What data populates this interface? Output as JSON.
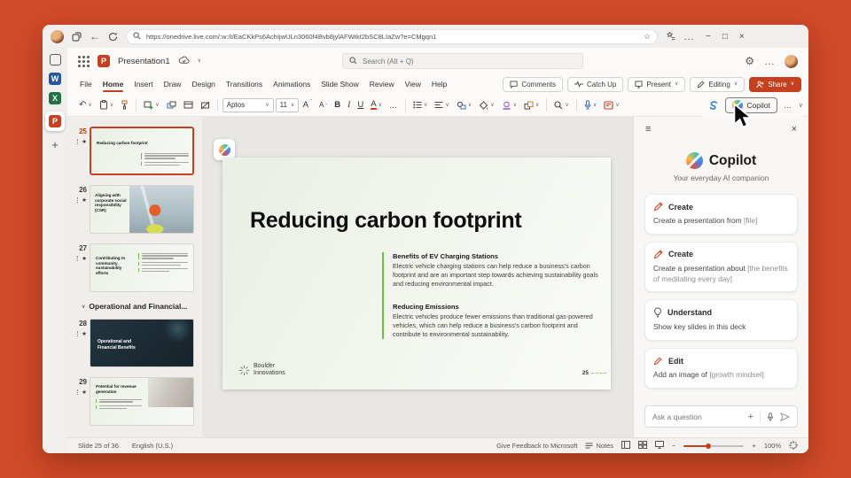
{
  "colors": {
    "accent": "#C4401F",
    "background_orange": "#D14B28",
    "green_accent": "#6FBE44"
  },
  "browser": {
    "url": "https://onedrive.live.com/:w:/t/EaCKkPs6AchIjwULn3060f4Bvb8jylAFWrkt2bSC8LIaZw?e=CMgqn1",
    "window_controls": {
      "minimize": "−",
      "maximize": "□",
      "close": "×"
    }
  },
  "rail": {
    "word": "W",
    "excel": "X",
    "powerpoint": "P",
    "new_tab": "+"
  },
  "app_header": {
    "title": "Presentation1",
    "search_placeholder": "Search (Alt + Q)"
  },
  "menu": {
    "items": [
      "File",
      "Home",
      "Insert",
      "Draw",
      "Design",
      "Transitions",
      "Animations",
      "Slide Show",
      "Review",
      "View",
      "Help"
    ]
  },
  "actions": {
    "comments": "Comments",
    "catch_up": "Catch Up",
    "present": "Present",
    "editing": "Editing",
    "share": "Share"
  },
  "toolbar": {
    "font_name": "Aptos",
    "font_size": "11",
    "bold": "B",
    "italic": "I",
    "underline": "U",
    "grow_font": "A",
    "shrink_font": "A",
    "font_color": "A",
    "copilot": "Copilot"
  },
  "icons": {
    "chevron": "∨",
    "ellipsis": "…",
    "undo": "↶",
    "back": "←",
    "plus": "+",
    "minus": "−",
    "star": "★",
    "star_outline": "☆",
    "hamburger": "≡",
    "gear": "⚙",
    "close": "×",
    "maximize": "□",
    "section_chevron": "⌄"
  },
  "thumbnails": [
    {
      "number": "25",
      "title": "Reducing carbon footprint"
    },
    {
      "number": "26",
      "title": "Aligning with corporate social responsibility (CSR)"
    },
    {
      "number": "27",
      "title": "Contributing to community sustainability efforts"
    },
    {
      "number": "28",
      "title": "Operational and Financial Benefits"
    },
    {
      "number": "29",
      "title": "Potential for revenue generation"
    }
  ],
  "section_header": "Operational and Financial...",
  "slide": {
    "title": "Reducing carbon footprint",
    "blocks": [
      {
        "heading": "Benefits of EV Charging Stations",
        "body": "Electric vehicle charging stations can help reduce a business's carbon footprint and are an important step towards achieving sustainability goals and reducing environmental impact."
      },
      {
        "heading": "Reducing Emissions",
        "body": "Electric vehicles produce fewer emissions than traditional gas-powered vehicles, which can help reduce a business's carbon footprint and contribute to environmental sustainability."
      }
    ],
    "logo_line1": "Boulder",
    "logo_line2": "Innovations",
    "page_number": "25"
  },
  "copilot": {
    "title": "Copilot",
    "subtitle": "Your everyday AI companion",
    "cards": [
      {
        "label": "Create",
        "text": "Create a presentation from ",
        "muted": "[file]"
      },
      {
        "label": "Create",
        "text": "Create a presentation about ",
        "muted": "[the benefits of meditating every day]"
      },
      {
        "label": "Understand",
        "text": "Show key slides in this deck",
        "muted": ""
      },
      {
        "label": "Edit",
        "text": "Add an image of ",
        "muted": "[growth mindset]"
      }
    ],
    "input_placeholder": "Ask a question"
  },
  "status": {
    "slide_info": "Slide 25 of 36",
    "language": "English (U.S.)",
    "feedback": "Give Feedback to Microsoft",
    "notes": "Notes",
    "zoom_level": "100%"
  }
}
